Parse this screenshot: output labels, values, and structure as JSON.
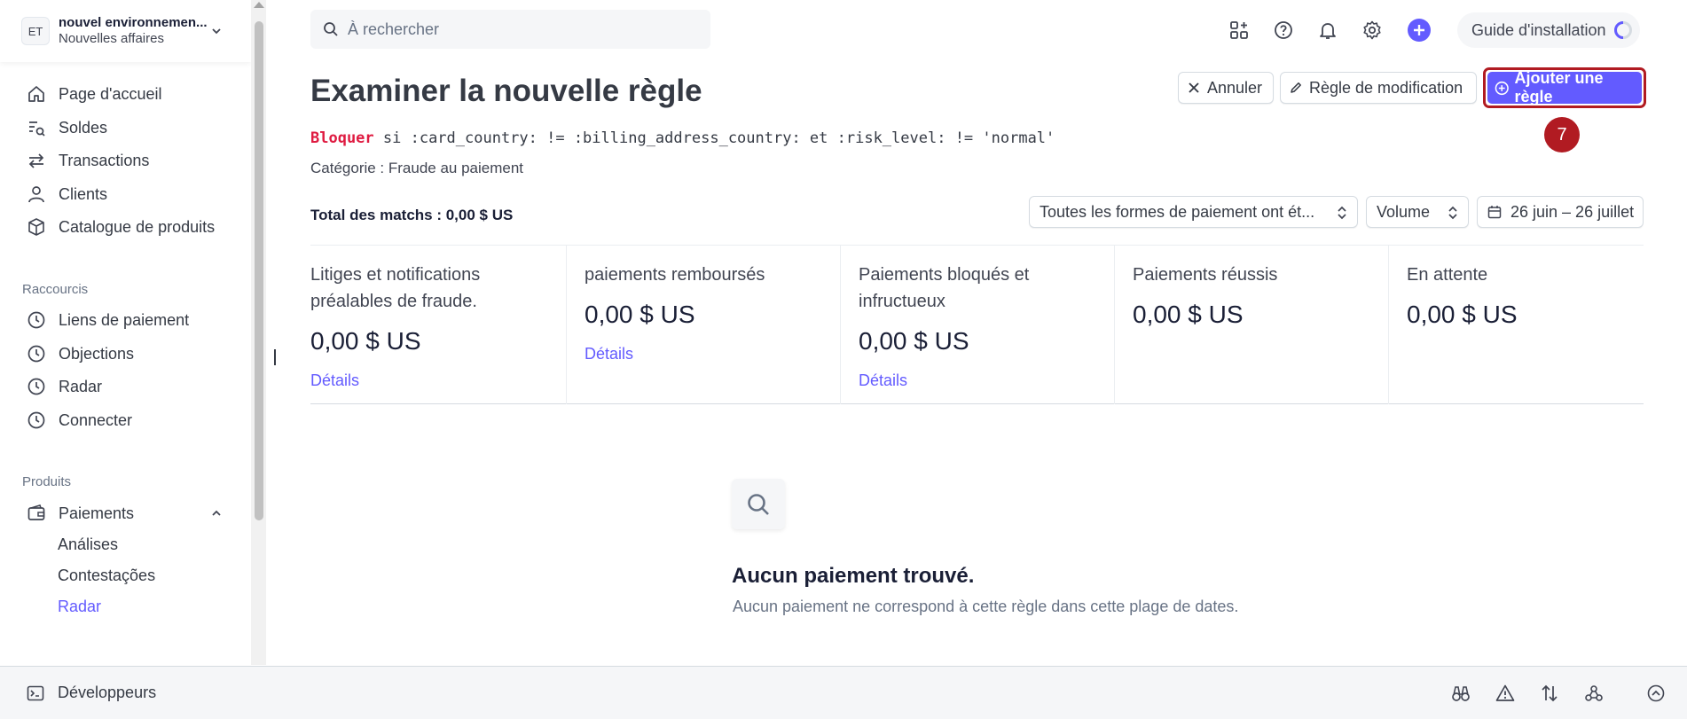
{
  "account": {
    "initials": "ET",
    "name": "nouvel environnemen...",
    "business": "Nouvelles affaires"
  },
  "sidebar": {
    "main_items": [
      {
        "label": "Page d'accueil",
        "icon": "home-icon"
      },
      {
        "label": "Soldes",
        "icon": "balances-icon"
      },
      {
        "label": "Transactions",
        "icon": "transfer-arrows-icon"
      },
      {
        "label": "Clients",
        "icon": "person-icon"
      },
      {
        "label": "Catalogue de produits",
        "icon": "box-icon"
      }
    ],
    "shortcuts_label": "Raccourcis",
    "shortcuts": [
      {
        "label": "Liens de paiement",
        "icon": "clock-icon"
      },
      {
        "label": "Objections",
        "icon": "clock-icon"
      },
      {
        "label": "Radar",
        "icon": "clock-icon"
      },
      {
        "label": "Connecter",
        "icon": "clock-icon"
      }
    ],
    "products_label": "Produits",
    "payments": {
      "label": "Paiements",
      "icon": "wallet-icon"
    },
    "payments_sub": [
      "Análises",
      "Contestações",
      "Radar"
    ]
  },
  "topbar": {
    "search_placeholder": "À rechercher",
    "guide_label": "Guide d'installation",
    "icons": [
      "apps-add-icon",
      "help-icon",
      "bell-icon",
      "gear-icon",
      "plus-icon"
    ]
  },
  "header": {
    "title": "Examiner la nouvelle règle",
    "cancel_label": "Annuler",
    "edit_label": "Règle de modification",
    "add_label": "Ajouter une règle",
    "step_badge": "7"
  },
  "rule": {
    "keyword": "Bloquer",
    "expression": " si :card_country: != :billing_address_country: et :risk_level: != 'normal'",
    "category": "Catégorie : Fraude au paiement"
  },
  "filters": {
    "total_matches": "Total des matchs : 0,00 $ US",
    "payment_forms": "Toutes les formes de paiement ont ét...",
    "metric": "Volume",
    "date_range": "26 juin – 26 juillet"
  },
  "metrics": [
    {
      "label": "Litiges et notifications préalables de fraude.",
      "value": "0,00 $ US",
      "link": "Détails"
    },
    {
      "label": "paiements remboursés",
      "value": "0,00 $ US",
      "link": "Détails"
    },
    {
      "label": "Paiements bloqués et infructueux",
      "value": "0,00 $ US",
      "link": "Détails"
    },
    {
      "label": "Paiements réussis",
      "value": "0,00 $ US",
      "link": ""
    },
    {
      "label": "En attente",
      "value": "0,00 $ US",
      "link": ""
    }
  ],
  "empty_state": {
    "title": "Aucun paiement trouvé.",
    "subtitle": "Aucun paiement ne correspond à cette règle dans cette plage de dates."
  },
  "bottombar": {
    "developers_label": "Développeurs",
    "icons": [
      "binoculars-icon",
      "warning-icon",
      "sort-arrows-icon",
      "webhook-icon",
      "chevron-up-circle-icon"
    ]
  },
  "colors": {
    "accent": "#635bff",
    "highlight_red": "#b11b22",
    "keyword_red": "#df1b41"
  }
}
